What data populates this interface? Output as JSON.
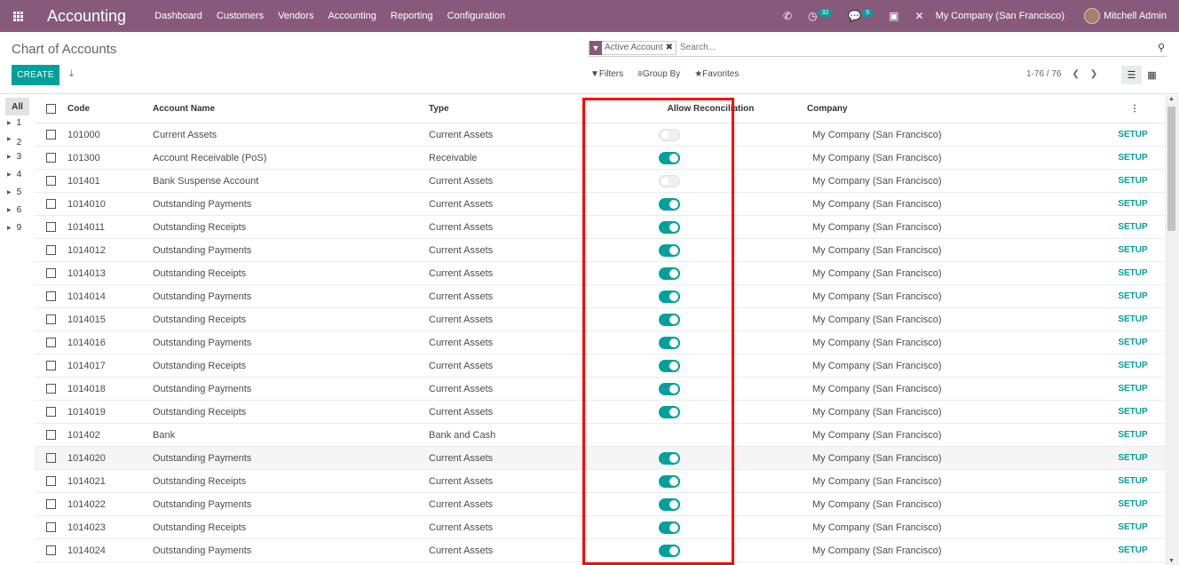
{
  "navbar": {
    "app_name": "Accounting",
    "menu": [
      "Dashboard",
      "Customers",
      "Vendors",
      "Accounting",
      "Reporting",
      "Configuration"
    ],
    "activity_count": "32",
    "messages_count": "5",
    "company": "My Company (San Francisco)",
    "user": "Mitchell Admin"
  },
  "control_panel": {
    "title": "Chart of Accounts",
    "create_label": "CREATE",
    "facet_label": "Active Account",
    "search_placeholder": "Search...",
    "filters_label": "Filters",
    "groupby_label": "Group By",
    "favorites_label": "Favorites",
    "pager": "1-76 / 76"
  },
  "sidebar": {
    "all_label": "All",
    "items": [
      "1",
      "2",
      "3",
      "4",
      "5",
      "6",
      "9"
    ]
  },
  "table": {
    "headers": {
      "code": "Code",
      "name": "Account Name",
      "type": "Type",
      "reconcile": "Allow Reconciliation",
      "company": "Company"
    },
    "setup_label": "SETUP",
    "rows": [
      {
        "code": "101000",
        "name": "Current Assets",
        "type": "Current Assets",
        "reconcile": "off",
        "company": "My Company (San Francisco)"
      },
      {
        "code": "101300",
        "name": "Account Receivable (PoS)",
        "type": "Receivable",
        "reconcile": "on",
        "company": "My Company (San Francisco)"
      },
      {
        "code": "101401",
        "name": "Bank Suspense Account",
        "type": "Current Assets",
        "reconcile": "off",
        "company": "My Company (San Francisco)"
      },
      {
        "code": "1014010",
        "name": "Outstanding Payments",
        "type": "Current Assets",
        "reconcile": "on",
        "company": "My Company (San Francisco)"
      },
      {
        "code": "1014011",
        "name": "Outstanding Receipts",
        "type": "Current Assets",
        "reconcile": "on",
        "company": "My Company (San Francisco)"
      },
      {
        "code": "1014012",
        "name": "Outstanding Payments",
        "type": "Current Assets",
        "reconcile": "on",
        "company": "My Company (San Francisco)"
      },
      {
        "code": "1014013",
        "name": "Outstanding Receipts",
        "type": "Current Assets",
        "reconcile": "on",
        "company": "My Company (San Francisco)"
      },
      {
        "code": "1014014",
        "name": "Outstanding Payments",
        "type": "Current Assets",
        "reconcile": "on",
        "company": "My Company (San Francisco)"
      },
      {
        "code": "1014015",
        "name": "Outstanding Receipts",
        "type": "Current Assets",
        "reconcile": "on",
        "company": "My Company (San Francisco)"
      },
      {
        "code": "1014016",
        "name": "Outstanding Payments",
        "type": "Current Assets",
        "reconcile": "on",
        "company": "My Company (San Francisco)"
      },
      {
        "code": "1014017",
        "name": "Outstanding Receipts",
        "type": "Current Assets",
        "reconcile": "on",
        "company": "My Company (San Francisco)"
      },
      {
        "code": "1014018",
        "name": "Outstanding Payments",
        "type": "Current Assets",
        "reconcile": "on",
        "company": "My Company (San Francisco)"
      },
      {
        "code": "1014019",
        "name": "Outstanding Receipts",
        "type": "Current Assets",
        "reconcile": "on",
        "company": "My Company (San Francisco)"
      },
      {
        "code": "101402",
        "name": "Bank",
        "type": "Bank and Cash",
        "reconcile": "none",
        "company": "My Company (San Francisco)"
      },
      {
        "code": "1014020",
        "name": "Outstanding Payments",
        "type": "Current Assets",
        "reconcile": "on",
        "company": "My Company (San Francisco)"
      },
      {
        "code": "1014021",
        "name": "Outstanding Receipts",
        "type": "Current Assets",
        "reconcile": "on",
        "company": "My Company (San Francisco)"
      },
      {
        "code": "1014022",
        "name": "Outstanding Payments",
        "type": "Current Assets",
        "reconcile": "on",
        "company": "My Company (San Francisco)"
      },
      {
        "code": "1014023",
        "name": "Outstanding Receipts",
        "type": "Current Assets",
        "reconcile": "on",
        "company": "My Company (San Francisco)"
      },
      {
        "code": "1014024",
        "name": "Outstanding Payments",
        "type": "Current Assets",
        "reconcile": "on",
        "company": "My Company (San Francisco)"
      }
    ]
  },
  "colors": {
    "navbar": "#875a7b",
    "accent": "#00a09d",
    "highlight": "#ff0000"
  }
}
